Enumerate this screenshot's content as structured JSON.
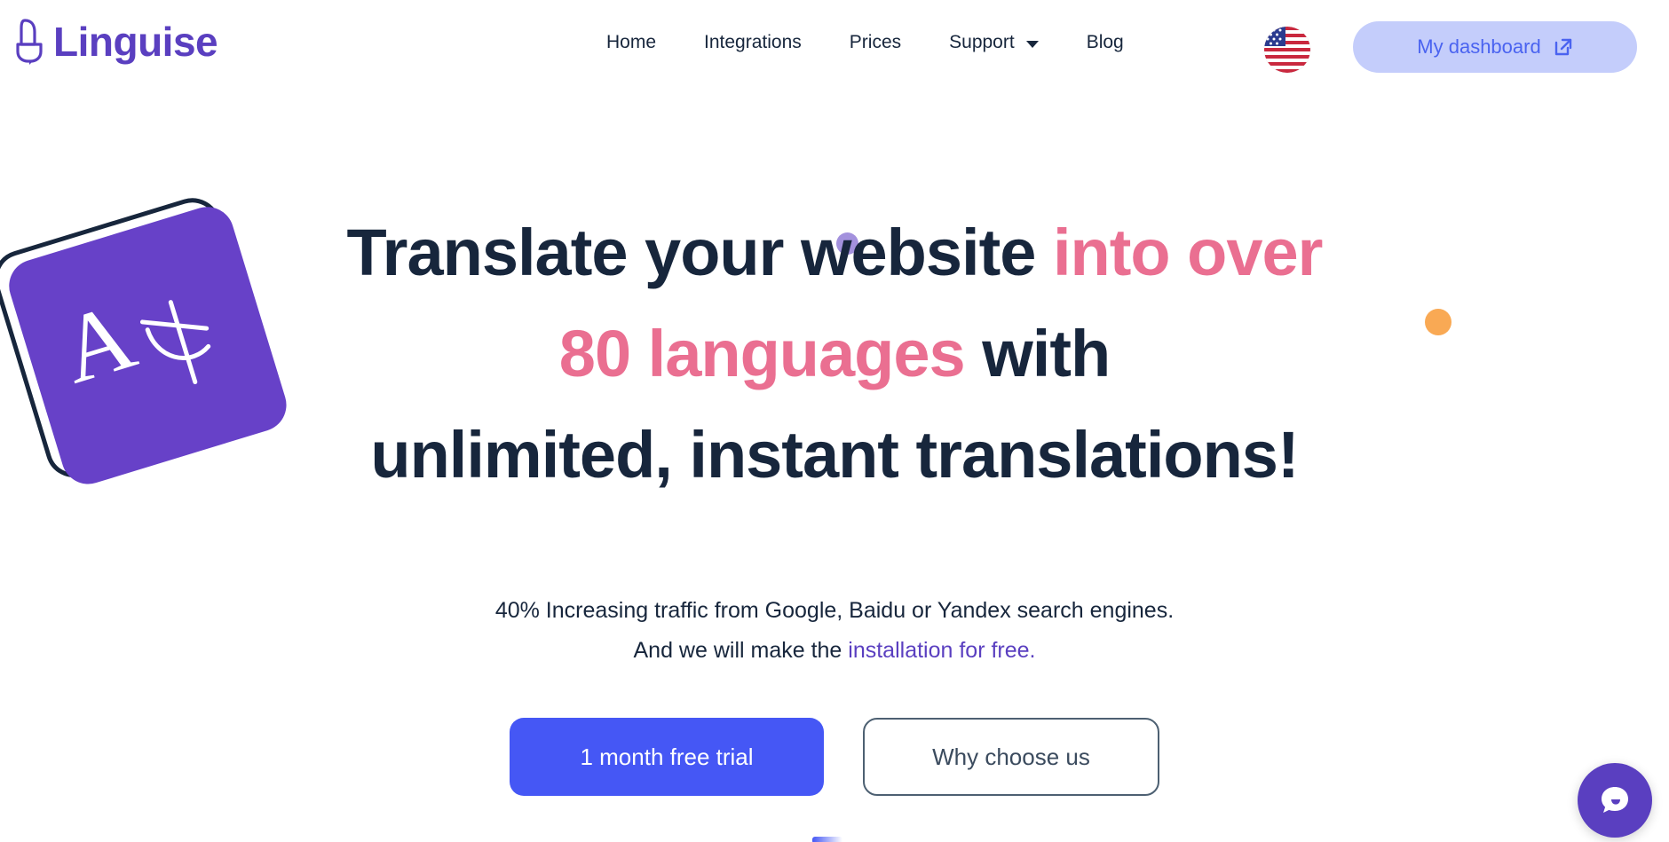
{
  "header": {
    "logo": {
      "text": "Linguise",
      "icon": "linguise-logo-icon"
    },
    "nav": [
      {
        "label": "Home",
        "has_dropdown": false
      },
      {
        "label": "Integrations",
        "has_dropdown": false
      },
      {
        "label": "Prices",
        "has_dropdown": false
      },
      {
        "label": "Support",
        "has_dropdown": true
      },
      {
        "label": "Blog",
        "has_dropdown": false
      }
    ],
    "language_flag": "us-flag-icon",
    "dashboard_button": {
      "label": "My dashboard",
      "icon": "external-link-icon",
      "bg": "#c4cdfb",
      "color": "#4a63f0"
    }
  },
  "hero": {
    "headline": {
      "line1_dark": "Translate your website ",
      "line1_pink": "into over",
      "line2_pink": "80 languages",
      "line2_dark": " with",
      "line3_dark": "unlimited, instant translations!"
    },
    "subtitle_line1": "40% Increasing traffic from Google, Baidu or Yandex search engines.",
    "subtitle_line2_prefix": "And we will make the ",
    "subtitle_link": "installation for free.",
    "cta": {
      "primary": "1 month free trial",
      "secondary": "Why choose us"
    },
    "decorations": {
      "card_letters": "A 文",
      "purple_dot": "#a391dd",
      "orange_dot": "#f9a954",
      "card_fill": "#6741c8"
    }
  },
  "chat": {
    "icon": "chat-bubble-icon",
    "bg": "#5a3fc0"
  },
  "colors": {
    "navy": "#17263c",
    "pink": "#ea6f91",
    "purple": "#5a3fc0",
    "blue": "#4557f5"
  }
}
